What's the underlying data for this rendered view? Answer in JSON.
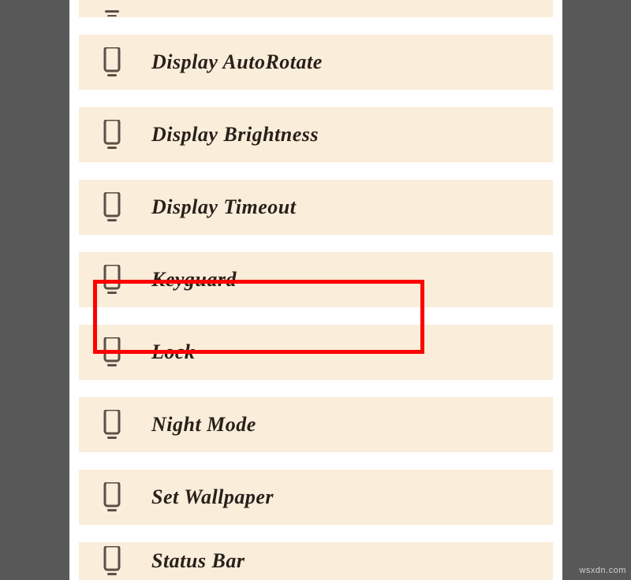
{
  "list": {
    "items": [
      {
        "label": ""
      },
      {
        "label": "Display AutoRotate"
      },
      {
        "label": "Display Brightness"
      },
      {
        "label": "Display Timeout"
      },
      {
        "label": "Keyguard"
      },
      {
        "label": "Lock"
      },
      {
        "label": "Night Mode"
      },
      {
        "label": "Set Wallpaper"
      },
      {
        "label": "Status Bar"
      }
    ],
    "highlighted_index": 5
  },
  "watermark": "wsxdn.com"
}
